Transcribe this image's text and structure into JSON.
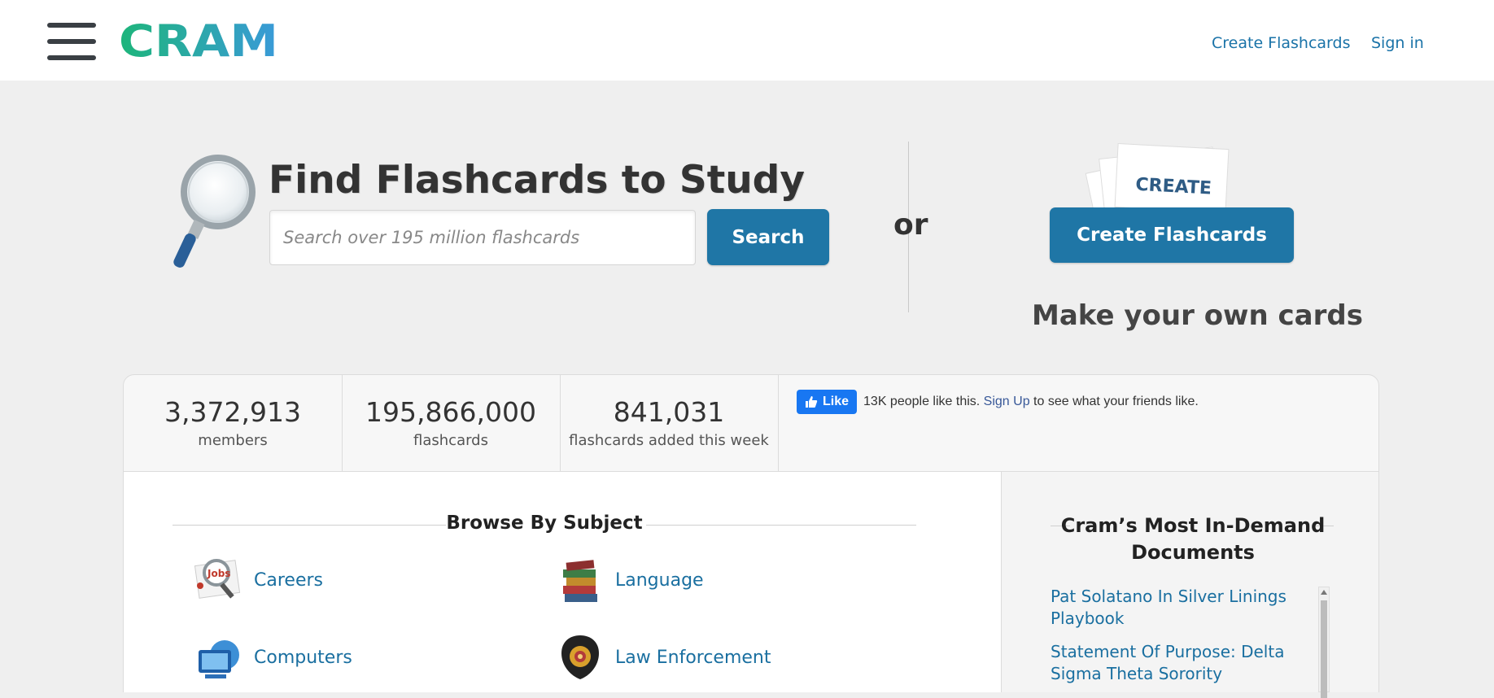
{
  "header": {
    "logo_text": "CRAM",
    "nav": {
      "create_flashcards": "Create Flashcards",
      "sign_in": "Sign in"
    }
  },
  "hero": {
    "title": "Find Flashcards to Study",
    "search_placeholder": "Search over 195 million flashcards",
    "search_button": "Search",
    "or_label": "or",
    "create_card_text": "CREATE",
    "create_button": "Create Flashcards",
    "create_subtitle": "Make your own cards"
  },
  "stats": [
    {
      "value": "3,372,913",
      "label": "members"
    },
    {
      "value": "195,866,000",
      "label": "flashcards"
    },
    {
      "value": "841,031",
      "label": "flashcards added this week"
    }
  ],
  "facebook": {
    "like_label": "Like",
    "count_text": "13K people like this.",
    "signup_link": "Sign Up",
    "suffix_text": "to see what your friends like."
  },
  "browse": {
    "title": "Browse By Subject",
    "subjects": [
      {
        "name": "Careers",
        "icon": "careers-icon"
      },
      {
        "name": "Language",
        "icon": "books-icon"
      },
      {
        "name": "Computers",
        "icon": "computers-icon"
      },
      {
        "name": "Law Enforcement",
        "icon": "badge-icon"
      }
    ]
  },
  "documents": {
    "title": "Cram’s Most In-Demand Documents",
    "items": [
      "Pat Solatano In Silver Linings Playbook",
      "Statement Of Purpose: Delta Sigma Theta Sorority"
    ]
  },
  "colors": {
    "primary": "#1f76a6",
    "link": "#1a6fa0",
    "logo_green": "#1db57a",
    "logo_blue": "#3a9ad9",
    "facebook": "#1877f2"
  }
}
